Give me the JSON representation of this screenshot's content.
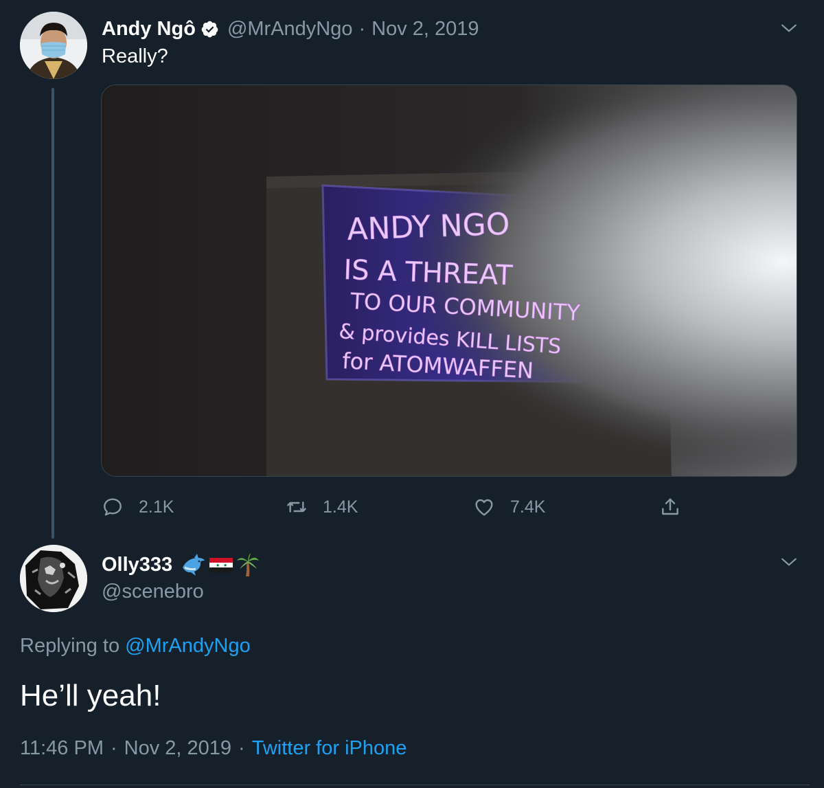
{
  "tweet": {
    "author_name": "Andy Ngô",
    "verified_icon": "verified-badge-icon",
    "handle": "@MrAndyNgo",
    "separator": "·",
    "date": "Nov 2, 2019",
    "text": "Really?",
    "media": {
      "sign_lines": [
        "ANDY NGO",
        "IS A THREAT",
        "TO OUR COMMUNITY",
        "& provides KILL LISTS",
        "for ATOMWAFFEN"
      ]
    },
    "actions": {
      "reply_count": "2.1K",
      "retweet_count": "1.4K",
      "like_count": "7.4K"
    }
  },
  "reply": {
    "author_name": "Olly333",
    "name_emojis": [
      "dolphin-emoji",
      "syria-flag-emoji",
      "palm-tree-emoji"
    ],
    "handle": "@scenebro",
    "replying_prefix": "Replying to",
    "replying_mention": "@MrAndyNgo",
    "text": "He’ll yeah!",
    "time": "11:46 PM",
    "separator": "·",
    "date": "Nov 2, 2019",
    "source": "Twitter for iPhone"
  },
  "colors": {
    "background": "#15202b",
    "secondary_text": "#8899a6",
    "link": "#1da1f2",
    "verified": "#ffffff"
  }
}
